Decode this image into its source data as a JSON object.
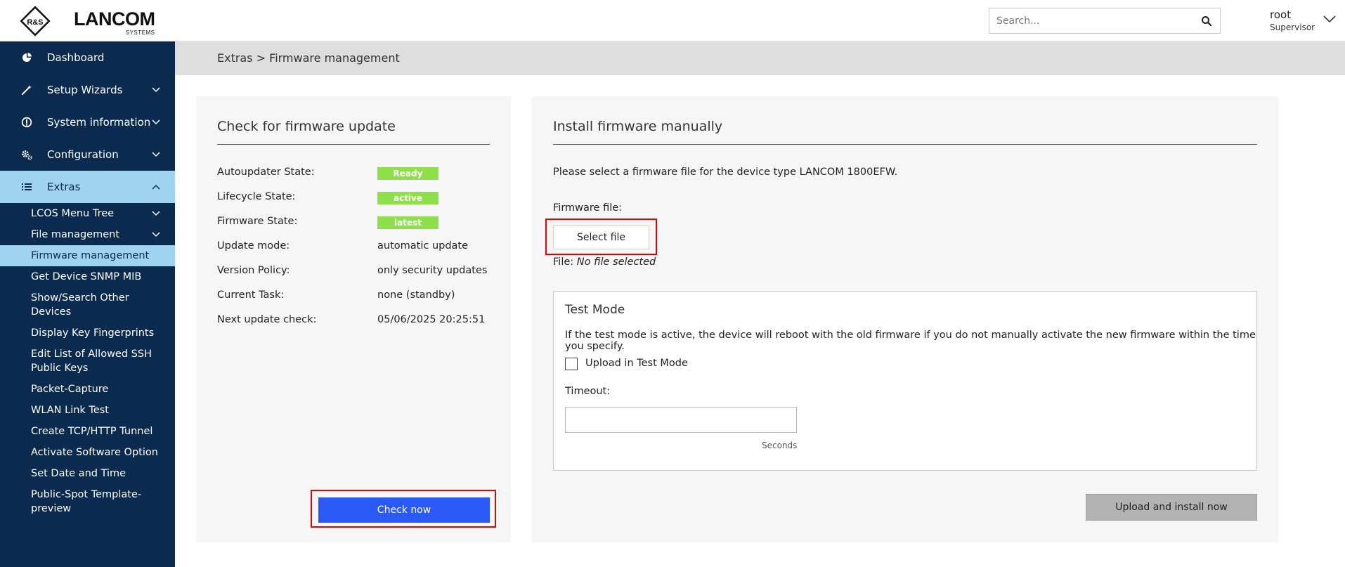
{
  "header": {
    "logo_letters": "R&S",
    "brand_name": "LANCOM",
    "brand_sub": "SYSTEMS",
    "search_placeholder": "Search...",
    "user_name": "root",
    "user_role": "Supervisor"
  },
  "sidebar": {
    "items": [
      {
        "label": "Dashboard",
        "icon": "dashboard-icon"
      },
      {
        "label": "Setup Wizards",
        "icon": "wand-icon"
      },
      {
        "label": "System information",
        "icon": "info-icon"
      },
      {
        "label": "Configuration",
        "icon": "gears-icon"
      },
      {
        "label": "Extras",
        "icon": "list-icon"
      }
    ],
    "sub_items": [
      {
        "label": "LCOS Menu Tree"
      },
      {
        "label": "File management"
      },
      {
        "label": "Firmware management"
      },
      {
        "label": "Get Device SNMP MIB"
      },
      {
        "label": "Show/Search Other Devices"
      },
      {
        "label": "Display Key Fingerprints"
      },
      {
        "label": "Edit List of Allowed SSH Public Keys"
      },
      {
        "label": "Packet-Capture"
      },
      {
        "label": "WLAN Link Test"
      },
      {
        "label": "Create TCP/HTTP Tunnel"
      },
      {
        "label": "Activate Software Option"
      },
      {
        "label": "Set Date and Time"
      },
      {
        "label": "Public-Spot Template-preview"
      }
    ]
  },
  "breadcrumb": "Extras > Firmware management",
  "update_panel": {
    "title": "Check for firmware update",
    "rows": [
      {
        "label": "Autoupdater State:",
        "value": "Ready"
      },
      {
        "label": "Lifecycle State:",
        "value": "active"
      },
      {
        "label": "Firmware State:",
        "value": "latest"
      },
      {
        "label": "Update mode:",
        "value": "automatic update"
      },
      {
        "label": "Version Policy:",
        "value": "only security updates"
      },
      {
        "label": "Current Task:",
        "value": "none (standby)"
      },
      {
        "label": "Next update check:",
        "value": "05/06/2025 20:25:51"
      }
    ],
    "check_button": "Check now"
  },
  "manual_panel": {
    "title": "Install firmware manually",
    "intro": "Please select a firmware file for the device type LANCOM 1800EFW.",
    "firmware_label": "Firmware file:",
    "select_button": "Select file",
    "file_prefix": "File:",
    "file_value": "No file selected",
    "test_mode": {
      "title": "Test Mode",
      "description": "If the test mode is active, the device will reboot with the old firmware if you do not manually activate the new firmware within the time you specify.",
      "checkbox_label": "Upload in Test Mode",
      "timeout_label": "Timeout:",
      "timeout_value": "",
      "seconds_label": "Seconds"
    },
    "upload_button": "Upload and install now"
  },
  "colors": {
    "sidebar_bg": "#0b2a4f",
    "highlight": "#9fd3f0",
    "badge_green": "#8ee04a",
    "primary_button": "#2b59f5",
    "focus_outline": "#e60000"
  }
}
